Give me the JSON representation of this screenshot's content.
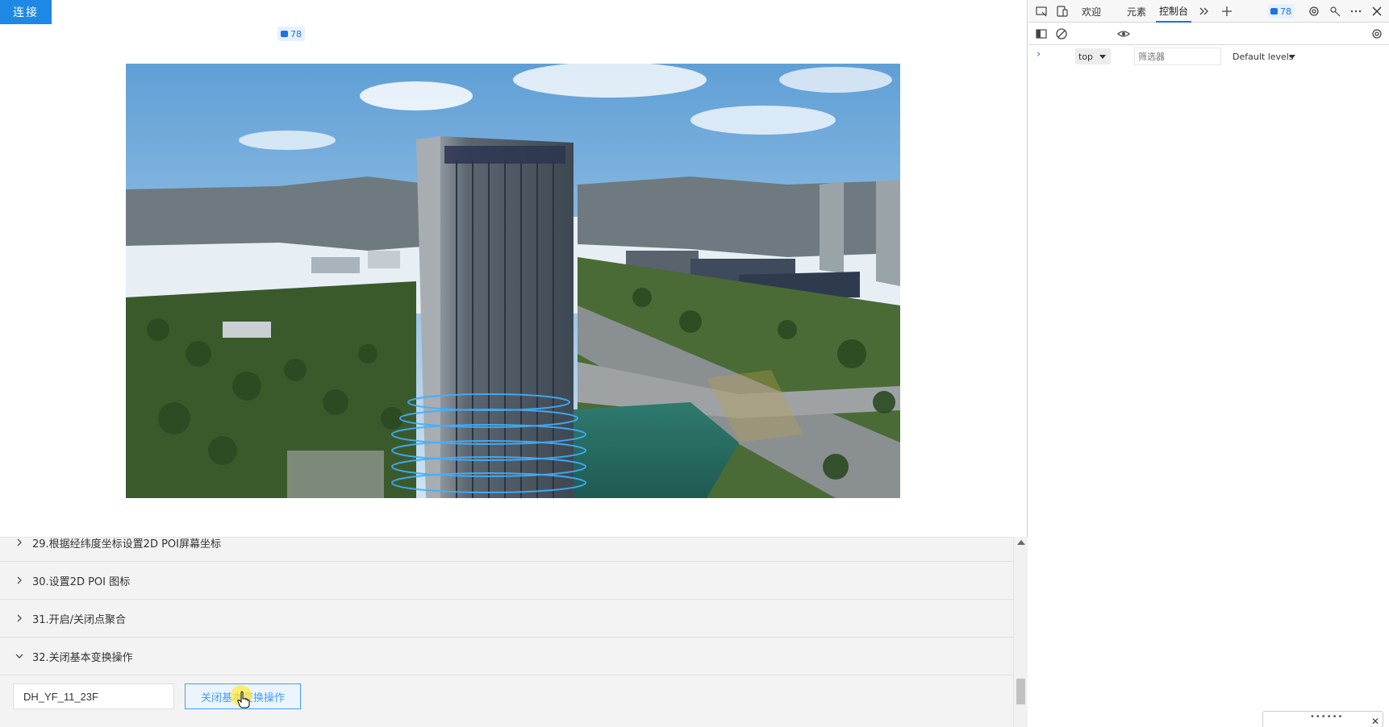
{
  "app": {
    "connect_label": "连接",
    "accordion": [
      {
        "label": "29.根据经纬度坐标设置2D POI屏幕坐标",
        "expanded": false
      },
      {
        "label": "30.设置2D POI 图标",
        "expanded": false
      },
      {
        "label": "31.开启/关闭点聚合",
        "expanded": false
      },
      {
        "label": "32.关闭基本变换操作",
        "expanded": true
      }
    ],
    "panel": {
      "input_value": "DH_YF_11_23F",
      "action_label": "关闭基本变换操作"
    }
  },
  "devtools": {
    "tabs": [
      {
        "label": "欢迎",
        "active": false
      },
      {
        "label": "元素",
        "active": false
      },
      {
        "label": "控制台",
        "active": true
      }
    ],
    "message_count": "78",
    "context": "top",
    "filter_placeholder": "筛选器",
    "levels_label": "Default levels",
    "prompt_symbol": "›",
    "drawer_grip": "••••••",
    "drawer_close": "✕"
  },
  "colors": {
    "accent": "#1e88e5",
    "button_border": "#409eff",
    "devtools_accent": "#1a73e8"
  }
}
